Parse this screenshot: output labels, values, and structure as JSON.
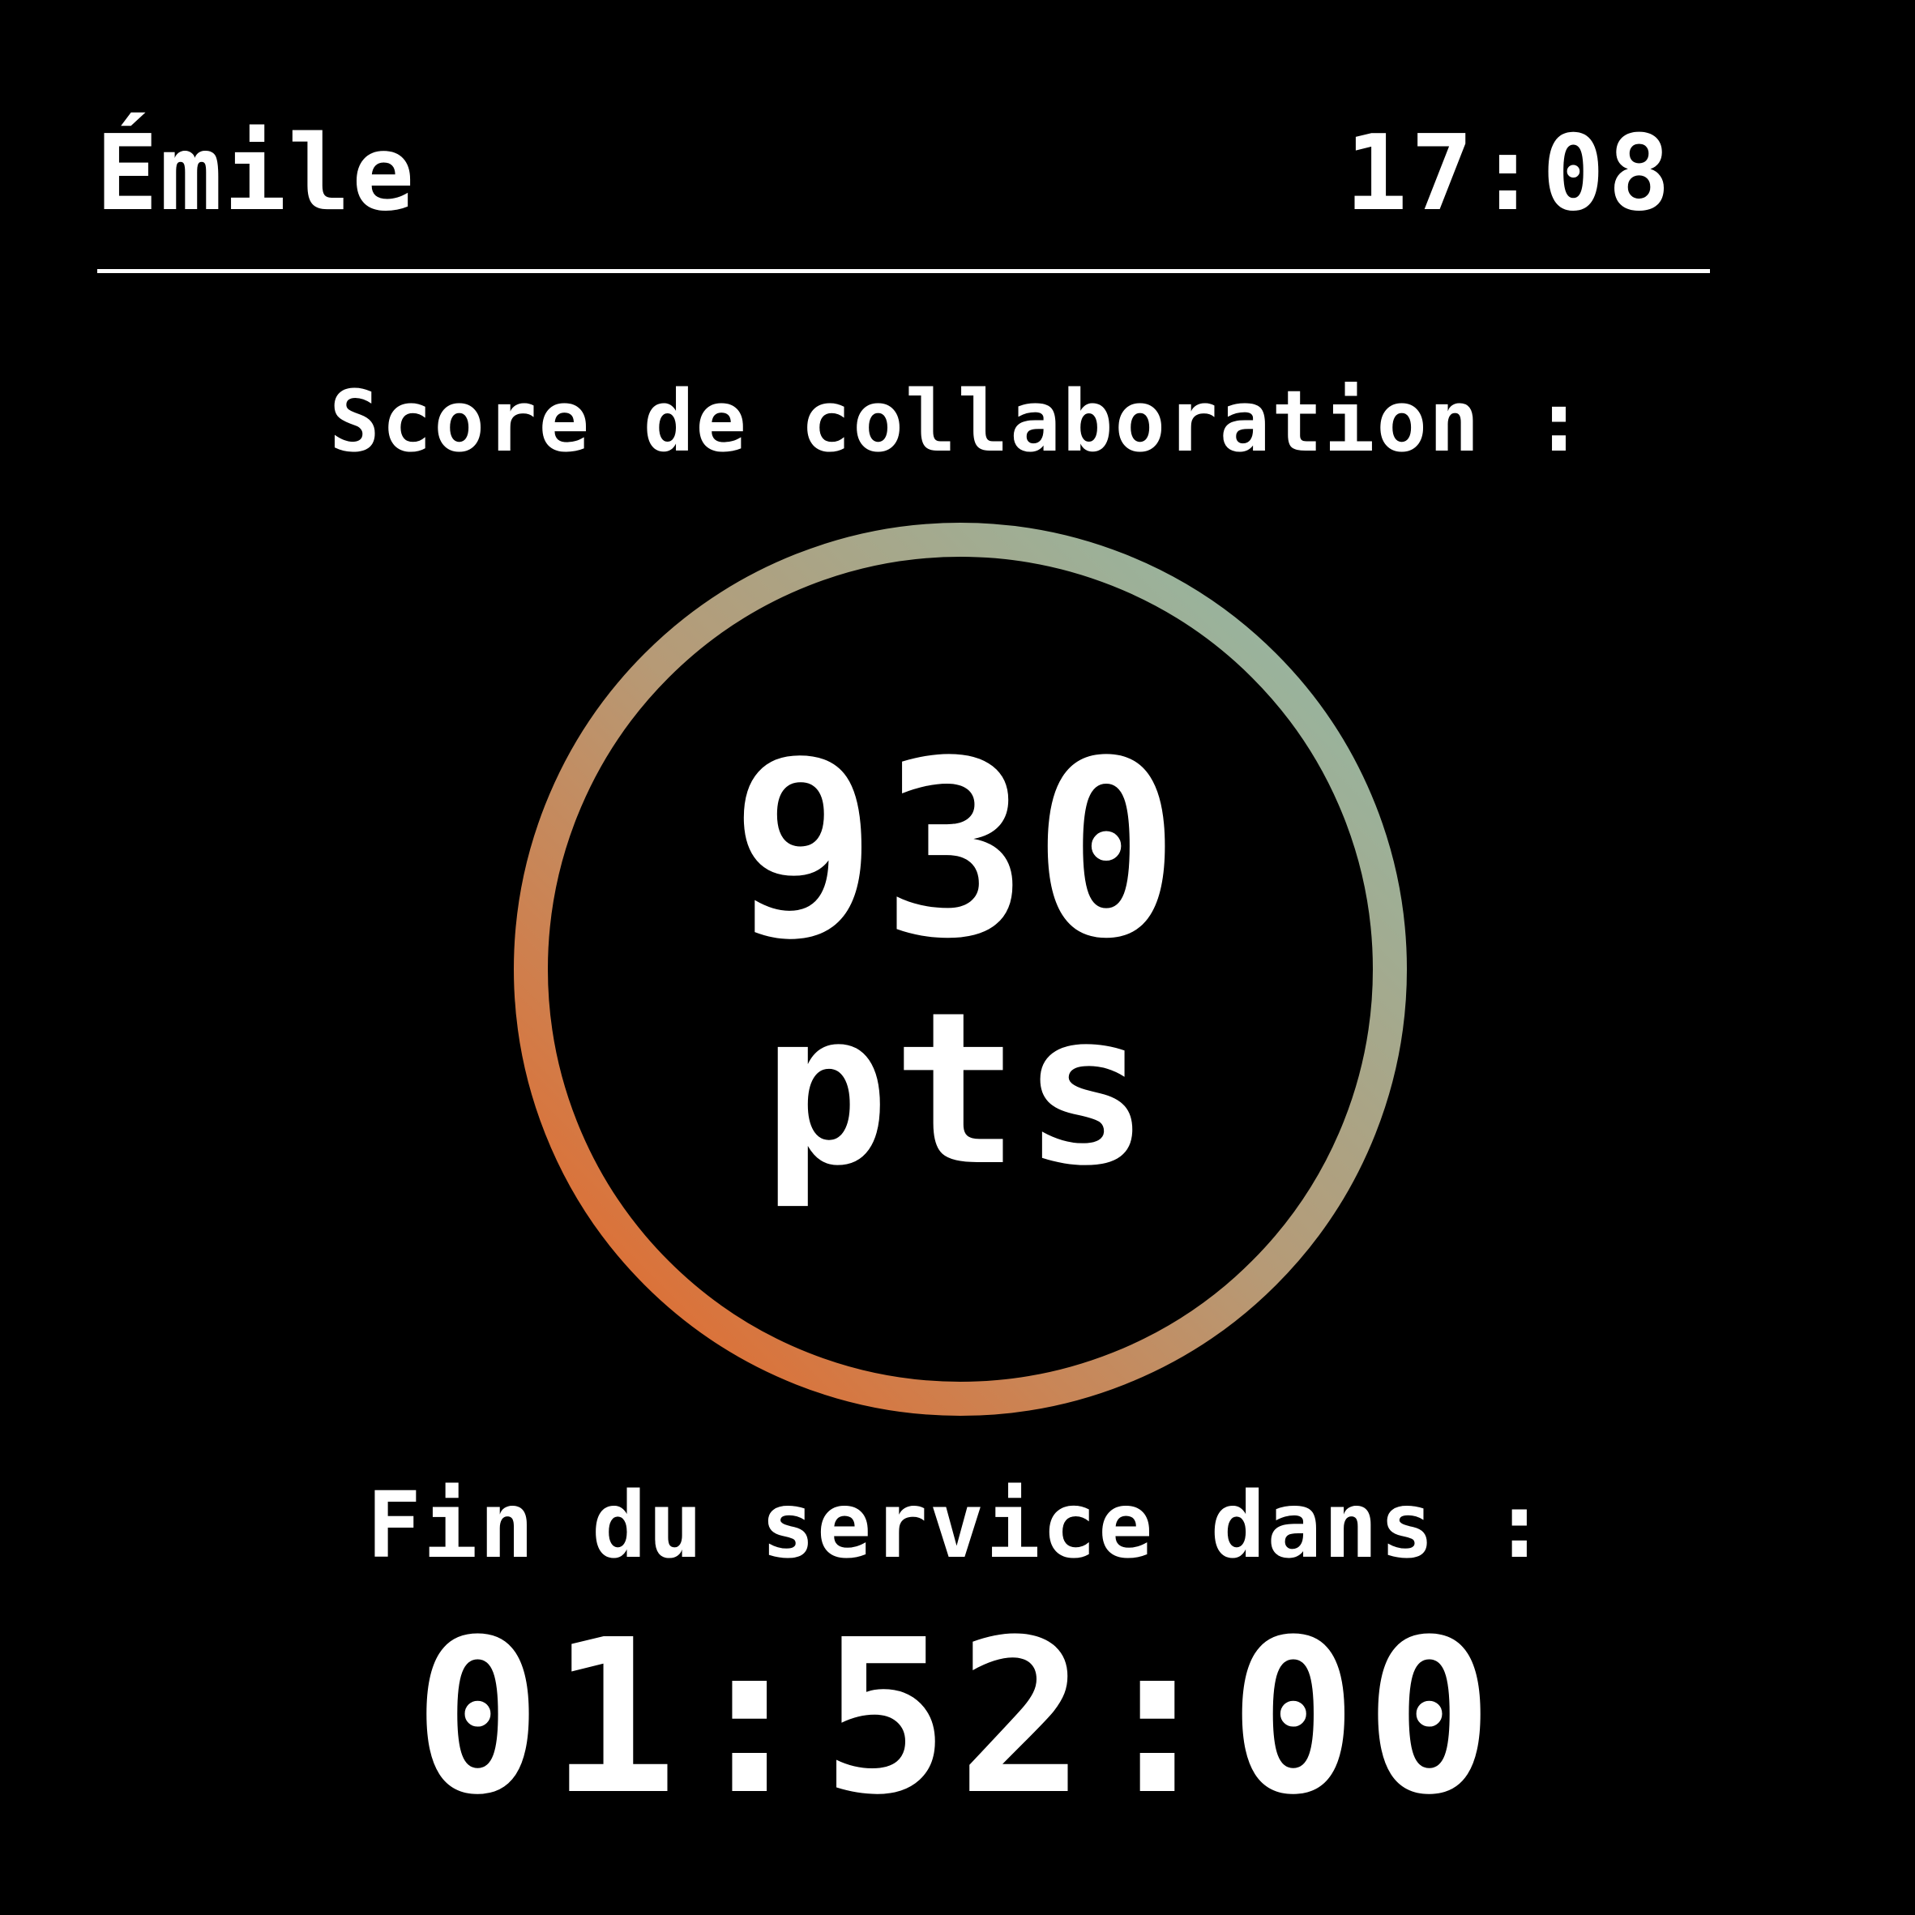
{
  "header": {
    "user_name": "Émile",
    "time": "17:08"
  },
  "score": {
    "label": "Score de collaboration :",
    "value": "930",
    "unit": "pts"
  },
  "service": {
    "label": "Fin du service dans :",
    "countdown": "01:52:00"
  },
  "colors": {
    "background": "#000000",
    "text": "#ffffff",
    "ring_start": "#e86424",
    "ring_mid": "#b69a76",
    "ring_end": "#8fbcaa"
  }
}
